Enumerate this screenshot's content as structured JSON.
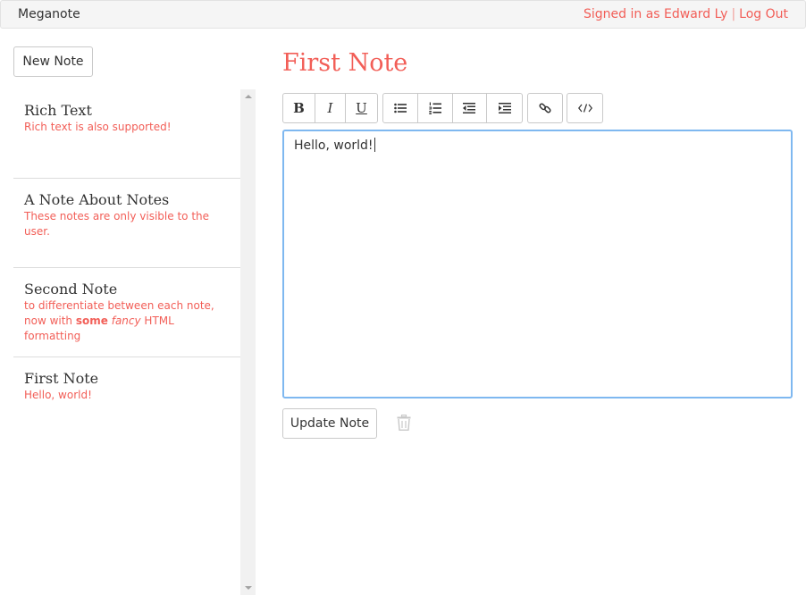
{
  "navbar": {
    "brand": "Meganote",
    "signed_in_text": "Signed in as Edward Ly",
    "separator": "|",
    "logout_label": "Log Out"
  },
  "sidebar": {
    "new_note_label": "New Note",
    "notes": [
      {
        "title": "Rich Text",
        "body": "Rich text is also supported!"
      },
      {
        "title": "A Note About Notes",
        "body": "These notes are only visible to the user."
      },
      {
        "title": "Second Note",
        "body_parts": [
          "to differentiate between each note, now with ",
          "some",
          " ",
          "fancy",
          " HTML formatting"
        ]
      },
      {
        "title": "First Note",
        "body": "Hello, world!"
      }
    ]
  },
  "main": {
    "title": "First Note",
    "toolbar": {
      "bold_icon": "bold-icon",
      "italic_icon": "italic-icon",
      "underline_icon": "underline-icon",
      "bullet_list_icon": "bullet-list-icon",
      "numbered_list_icon": "numbered-list-icon",
      "outdent_icon": "outdent-icon",
      "indent_icon": "indent-icon",
      "link_icon": "link-icon",
      "code_icon": "code-icon",
      "bold_label": "B",
      "italic_label": "I",
      "underline_label": "U"
    },
    "editor_content": "Hello, world!",
    "update_label": "Update Note",
    "delete_icon": "trash-icon"
  },
  "colors": {
    "accent": "#f25e57",
    "focus_border": "#7fb8f0",
    "navbar_bg": "#f5f5f5"
  }
}
